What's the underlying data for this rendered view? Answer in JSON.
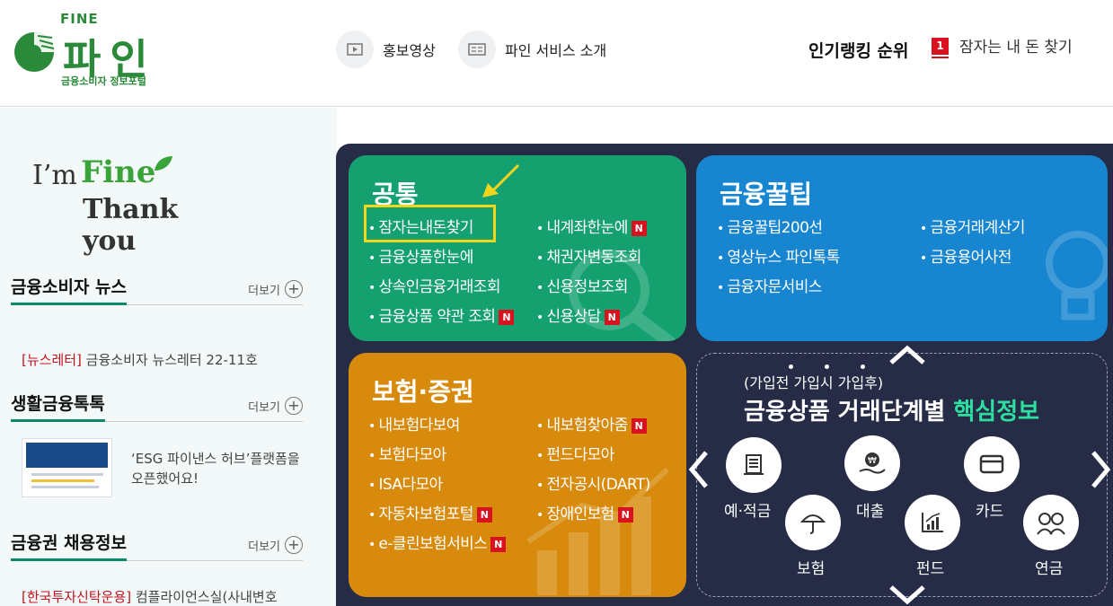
{
  "logo": {
    "fine": "FINE",
    "name": "파인",
    "subtitle": "금융소비자 정보포털"
  },
  "header": {
    "video_label": "홍보영상",
    "intro_label": "파인 서비스 소개",
    "ranking_title": "인기랭킹 순위",
    "ranking_num": "1",
    "ranking_text": "잠자는 내 돈 찾기"
  },
  "side": {
    "im": "I’m",
    "fine": "Fine",
    "thank": "Thank you",
    "more_label": "더보기",
    "news": {
      "title": "금융소비자 뉴스",
      "tag": "[뉴스레터]",
      "text": " 금융소비자 뉴스레터 22-11호"
    },
    "life": {
      "title": "생활금융톡톡",
      "text": "‘ESG 파이낸스 허브’플랫폼을 오픈했어요!"
    },
    "jobs": {
      "title": "금융권 채용정보",
      "tag": "[한국투자신탁운용]",
      "text": " 컴플라이언스실(사내변호"
    }
  },
  "cards": {
    "common": {
      "title": "공통",
      "links": [
        "잠자는내돈찾기",
        "금융상품한눈에",
        "상속인금융거래조회",
        "금융상품 약관 조회",
        "내계좌한눈에",
        "채권자변동조회",
        "신용정보조회",
        "신용상담"
      ]
    },
    "tip": {
      "title": "금융꿀팁",
      "links": [
        "금융꿀팁200선",
        "영상뉴스 파인톡톡",
        "금융자문서비스",
        "금융거래계산기",
        "금융용어사전"
      ]
    },
    "insurance": {
      "title": "보험·증권",
      "links": [
        "내보험다보여",
        "보험다모아",
        "ISA다모아",
        "자동차보험포털",
        "e-클린보험서비스",
        "내보험찾아줌",
        "펀드다모아",
        "전자공시(DART)",
        "장애인보험"
      ]
    }
  },
  "new_badge": "N",
  "stages": {
    "subtitle": "(가입전  가입시  가입후)",
    "title": "금융상품 거래단계별 ",
    "title_highlight": "핵심정보",
    "items": [
      "예·적금",
      "대출",
      "카드",
      "보험",
      "펀드",
      "연금"
    ]
  },
  "colors": {
    "common": "#14a06f",
    "tip": "#1785d0",
    "insurance": "#d78a0b",
    "panel": "#262b46",
    "highlight": "#2ee0a0",
    "badge": "#d9121f"
  }
}
